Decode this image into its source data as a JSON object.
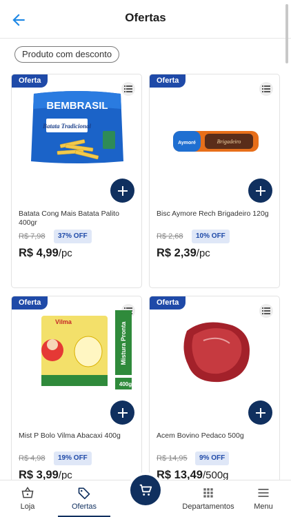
{
  "header": {
    "title": "Ofertas",
    "back_icon": "arrow-left-icon",
    "accent": "#1e88e5"
  },
  "filter": {
    "label": "Produto com desconto"
  },
  "badge_label": "Oferta",
  "products": [
    {
      "name": "Batata Cong Mais Batata Palito 400gr",
      "old_price": "R$ 7,98",
      "off": "37% OFF",
      "price": "R$ 4,99",
      "unit": "/pc",
      "brand_text": "BEMBRASIL",
      "sub_text": "Batata Tradicional"
    },
    {
      "name": "Bisc Aymore Rech Brigadeiro 120g",
      "old_price": "R$ 2,68",
      "off": "10% OFF",
      "price": "R$ 2,39",
      "unit": "/pc",
      "brand_text": "Aymoré",
      "sub_text": "Brigadeiro"
    },
    {
      "name": "Mist P Bolo Vilma Abacaxi 400g",
      "old_price": "R$ 4,98",
      "off": "19% OFF",
      "price": "R$ 3,99",
      "unit": "/pc",
      "brand_text": "Vilma",
      "sub_text": "Mistura Pronta",
      "weight": "400g"
    },
    {
      "name": "Acem Bovino Pedaco 500g",
      "old_price": "R$ 14,95",
      "off": "9% OFF",
      "price": "R$ 13,49",
      "unit": "/500g"
    }
  ],
  "nav": {
    "loja": "Loja",
    "ofertas": "Ofertas",
    "departamentos": "Departamentos",
    "menu": "Menu"
  },
  "colors": {
    "brand_dark": "#10305f",
    "badge_blue": "#1f4aa8",
    "off_bg": "#dfe7f7"
  }
}
